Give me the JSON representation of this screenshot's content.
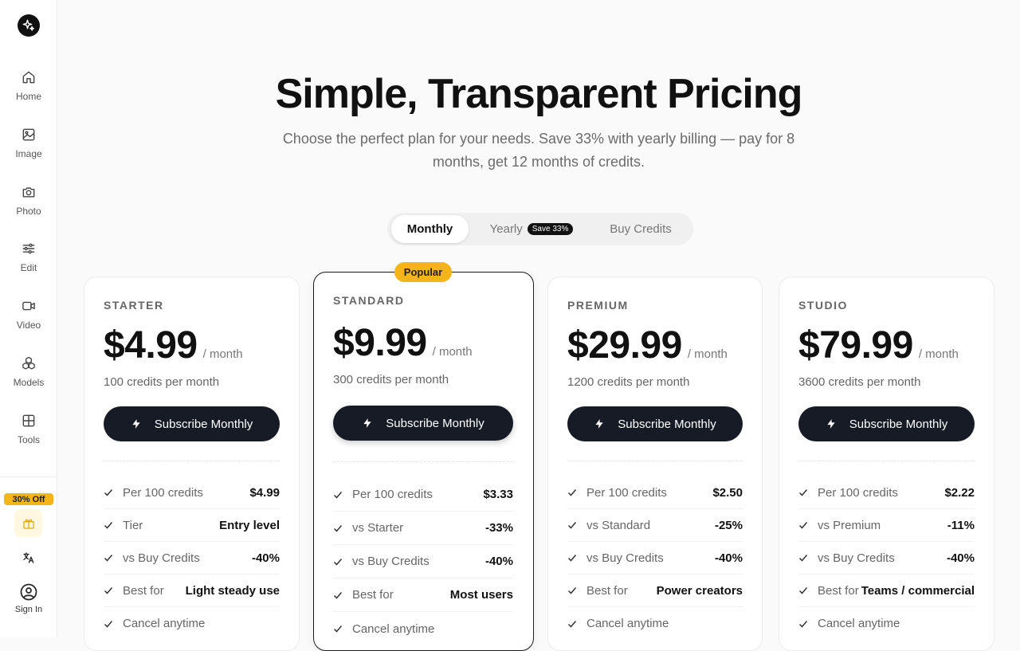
{
  "sidebar": {
    "items": [
      {
        "label": "Home",
        "icon": "home-icon"
      },
      {
        "label": "Image",
        "icon": "image-icon"
      },
      {
        "label": "Photo",
        "icon": "camera-icon"
      },
      {
        "label": "Edit",
        "icon": "sliders-icon"
      },
      {
        "label": "Video",
        "icon": "video-icon"
      },
      {
        "label": "Models",
        "icon": "models-icon"
      },
      {
        "label": "Tools",
        "icon": "grid-icon"
      }
    ],
    "promo_badge": "30% Off",
    "sign_in": "Sign In"
  },
  "hero": {
    "title": "Simple, Transparent Pricing",
    "subtitle": "Choose the perfect plan for your needs. Save 33% with yearly billing — pay for 8 months, get 12 months of credits."
  },
  "billing_toggle": {
    "monthly": "Monthly",
    "yearly": "Yearly",
    "yearly_badge": "Save 33%",
    "credits": "Buy Credits",
    "selected": "Monthly"
  },
  "plans": [
    {
      "name": "STARTER",
      "price": "$4.99",
      "period": "/ month",
      "credits": "100 credits per month",
      "button": "Subscribe Monthly",
      "features": [
        {
          "label": "Per 100 credits",
          "value": "$4.99"
        },
        {
          "label": "Tier",
          "value": "Entry level"
        },
        {
          "label": "vs Buy Credits",
          "value": "-40%"
        },
        {
          "label": "Best for",
          "value": "Light steady use"
        },
        {
          "label": "Cancel anytime",
          "value": ""
        }
      ]
    },
    {
      "name": "STANDARD",
      "badge": "Popular",
      "price": "$9.99",
      "period": "/ month",
      "credits": "300 credits per month",
      "button": "Subscribe Monthly",
      "features": [
        {
          "label": "Per 100 credits",
          "value": "$3.33"
        },
        {
          "label": "vs Starter",
          "value": "-33%"
        },
        {
          "label": "vs Buy Credits",
          "value": "-40%"
        },
        {
          "label": "Best for",
          "value": "Most users"
        },
        {
          "label": "Cancel anytime",
          "value": ""
        }
      ]
    },
    {
      "name": "PREMIUM",
      "price": "$29.99",
      "period": "/ month",
      "credits": "1200 credits per month",
      "button": "Subscribe Monthly",
      "features": [
        {
          "label": "Per 100 credits",
          "value": "$2.50"
        },
        {
          "label": "vs Standard",
          "value": "-25%"
        },
        {
          "label": "vs Buy Credits",
          "value": "-40%"
        },
        {
          "label": "Best for",
          "value": "Power creators"
        },
        {
          "label": "Cancel anytime",
          "value": ""
        }
      ]
    },
    {
      "name": "STUDIO",
      "price": "$79.99",
      "period": "/ month",
      "credits": "3600 credits per month",
      "button": "Subscribe Monthly",
      "features": [
        {
          "label": "Per 100 credits",
          "value": "$2.22"
        },
        {
          "label": "vs Premium",
          "value": "-11%"
        },
        {
          "label": "vs Buy Credits",
          "value": "-40%"
        },
        {
          "label": "Best for",
          "value": "Teams / commercial"
        },
        {
          "label": "Cancel anytime",
          "value": ""
        }
      ]
    }
  ]
}
